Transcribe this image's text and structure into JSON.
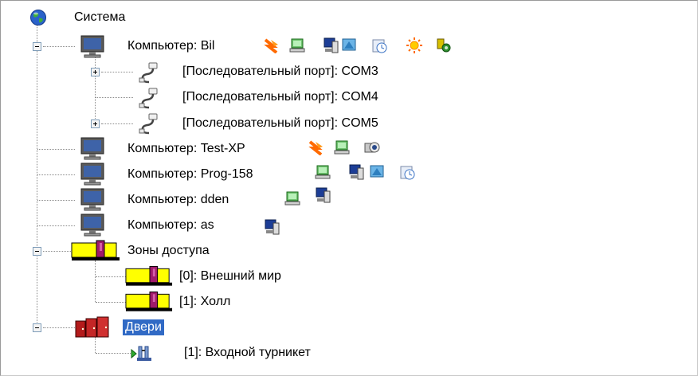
{
  "root": {
    "label": "Система",
    "icon": "globe-icon"
  },
  "computers": [
    {
      "label": "Компьютер: Bil",
      "expanded": true,
      "status_icons": [
        "alarm-icon",
        "workstation-icon",
        "terminal-icon",
        "monitor-icon",
        "clock-icon",
        "sun-icon",
        "key-icon"
      ]
    },
    {
      "label": "Компьютер: Test-XP",
      "status_icons": [
        "alarm-icon",
        "workstation-icon",
        "camera-icon"
      ]
    },
    {
      "label": "Компьютер: Prog-158",
      "status_icons": [
        "workstation-icon",
        "terminal-icon",
        "monitor-icon",
        "clock-icon"
      ]
    },
    {
      "label": "Компьютер: dden",
      "status_icons": [
        "workstation-icon",
        "terminal-icon"
      ]
    },
    {
      "label": "Компьютер: as",
      "status_icons": [
        "terminal-icon"
      ]
    }
  ],
  "ports": [
    {
      "label": "[Последовательный порт]: COM3",
      "expandable": true
    },
    {
      "label": "[Последовательный порт]: COM4",
      "expandable": false
    },
    {
      "label": "[Последовательный порт]: COM5",
      "expandable": true
    }
  ],
  "zones": {
    "label": "Зоны доступа",
    "items": [
      {
        "label": "[0]: Внешний мир"
      },
      {
        "label": "[1]: Холл"
      }
    ]
  },
  "doors": {
    "label": "Двери",
    "selected": true,
    "items": [
      {
        "label": "[1]: Входной турникет"
      }
    ]
  },
  "colors": {
    "selection": "#316ac5",
    "zone_yellow": "#ffff00",
    "door_red": "#b31b1b"
  }
}
